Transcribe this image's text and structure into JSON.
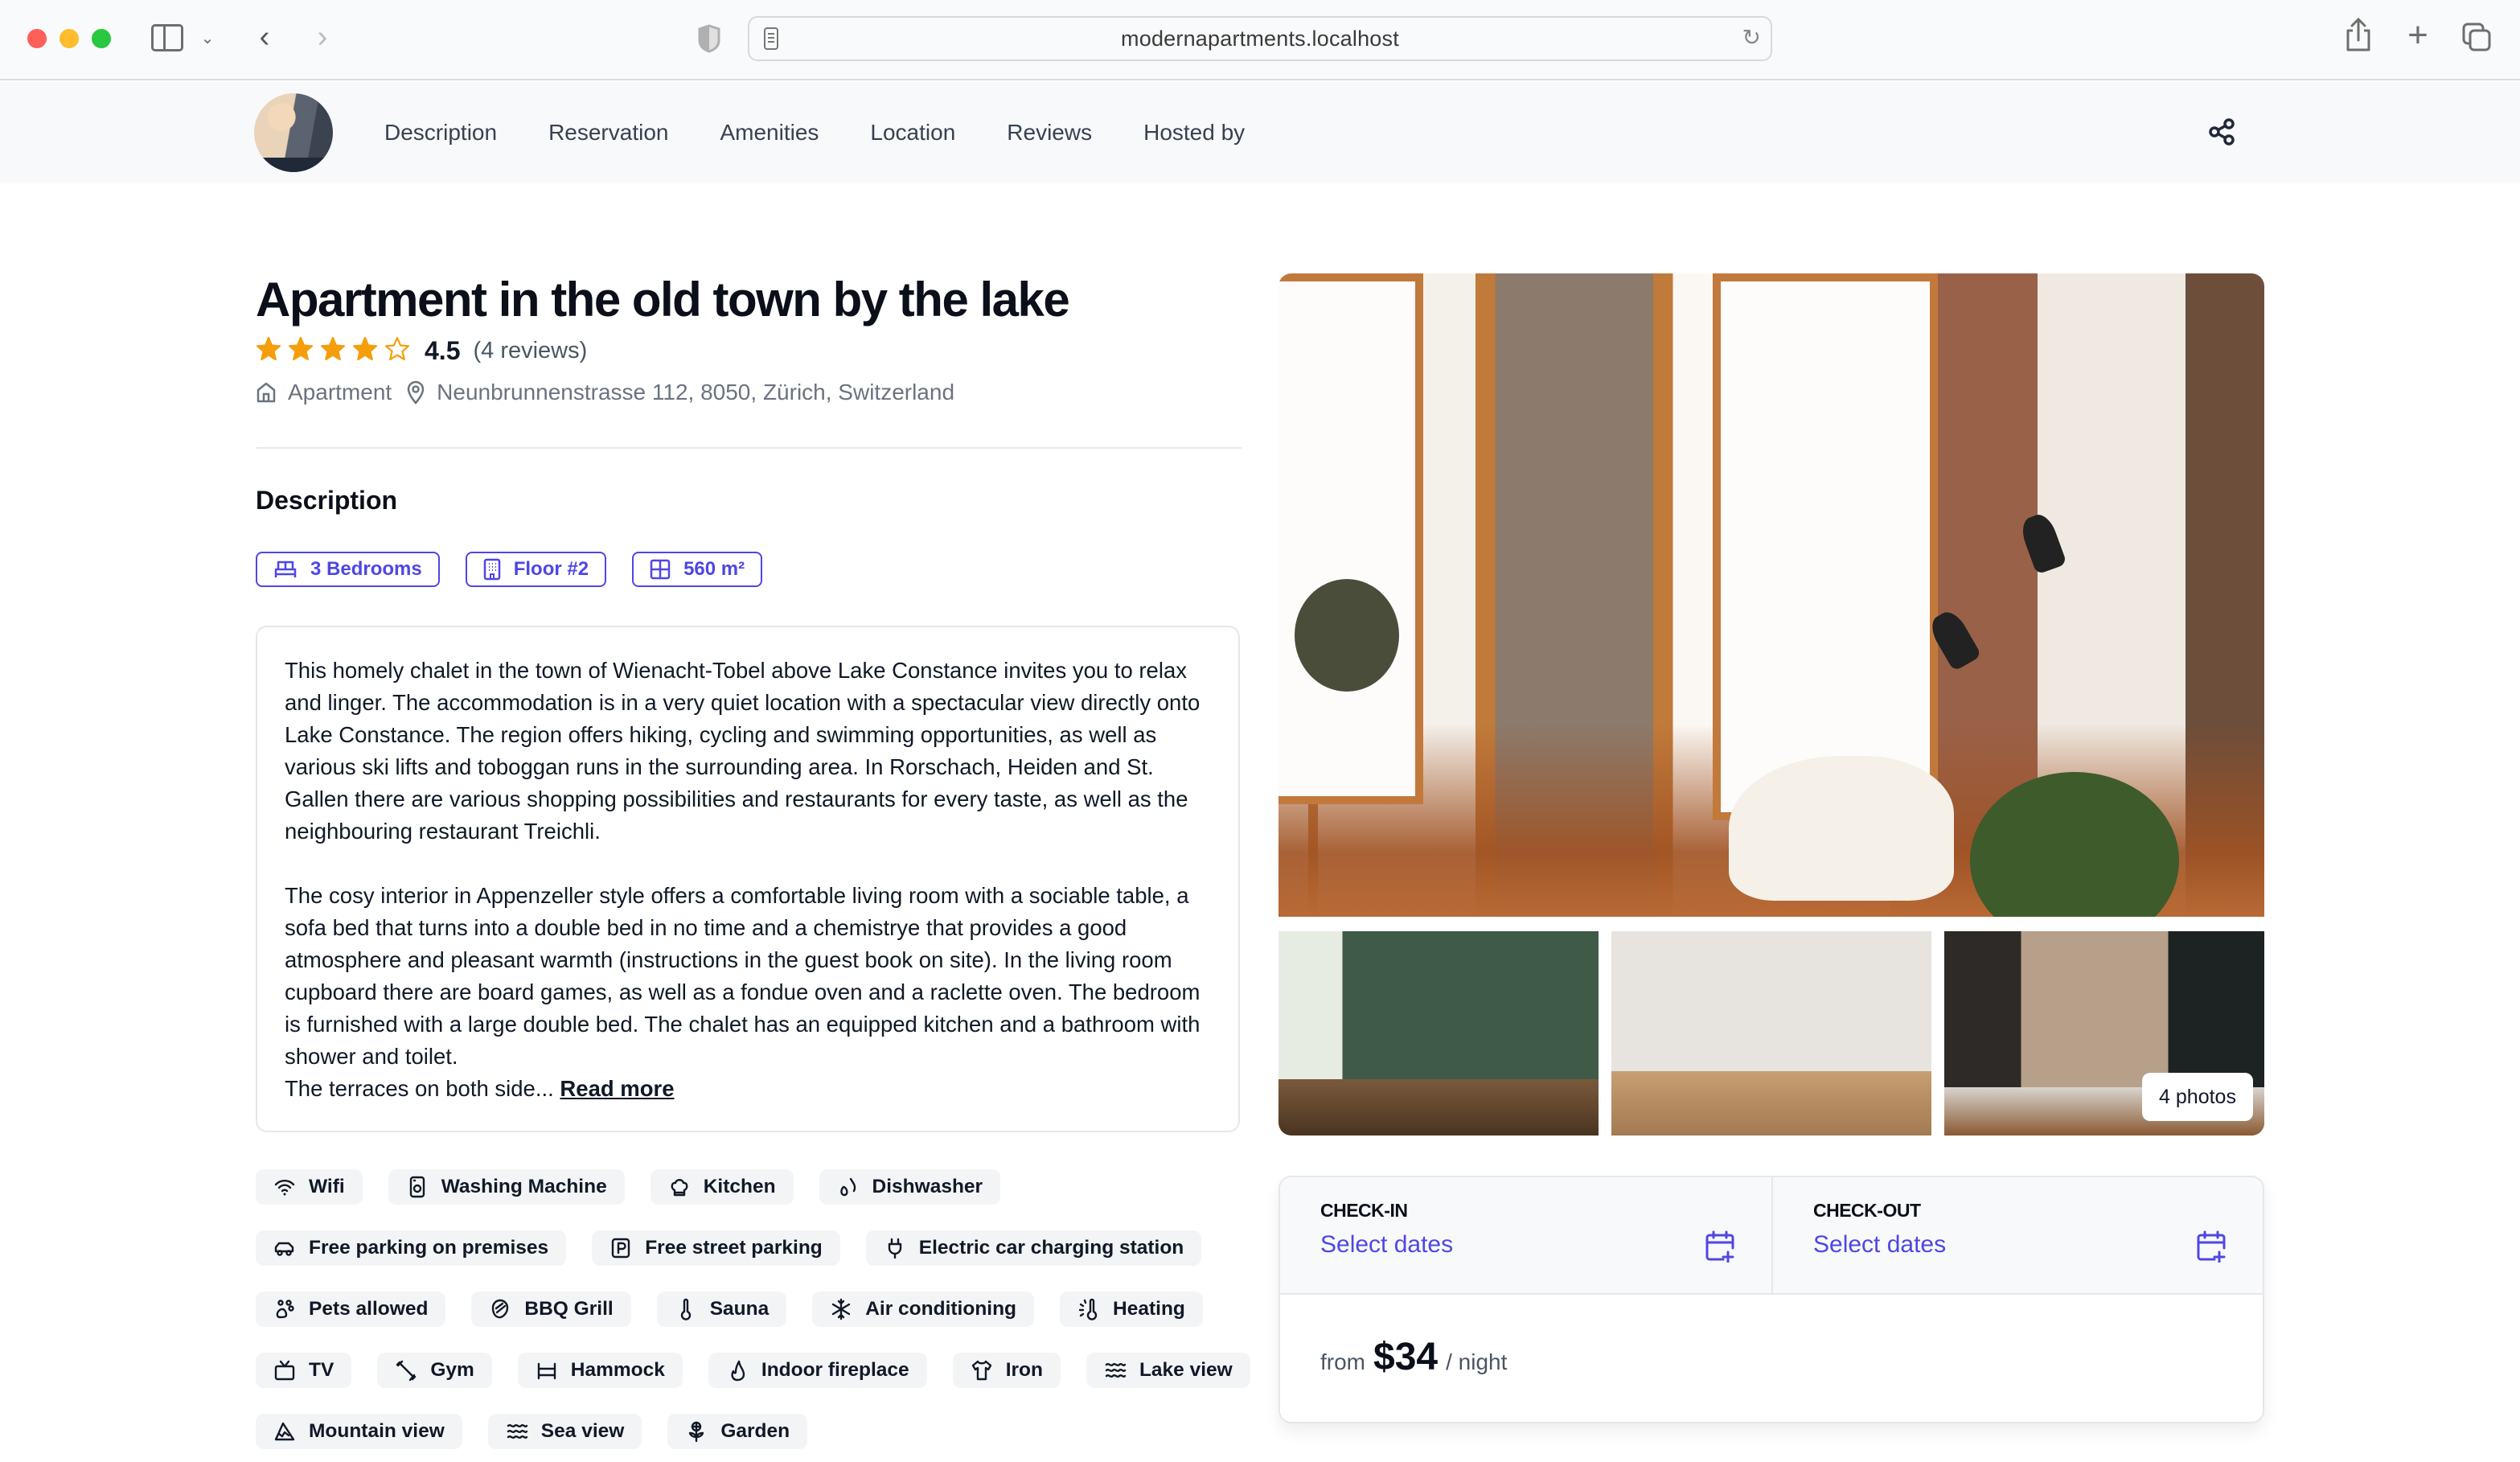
{
  "browser": {
    "url": "modernapartments.localhost"
  },
  "nav": {
    "links": [
      "Description",
      "Reservation",
      "Amenities",
      "Location",
      "Reviews",
      "Hosted by"
    ]
  },
  "listing": {
    "title": "Apartment in the old town by the lake",
    "rating": {
      "value": "4.5",
      "stars": 4.5,
      "max_stars": 5,
      "count_label": "(4 reviews)"
    },
    "type": "Apartment",
    "address": "Neunbrunnenstrasse 112, 8050, Zürich, Switzerland"
  },
  "description": {
    "title": "Description",
    "features": [
      {
        "icon": "bed-icon",
        "label": "3 Bedrooms"
      },
      {
        "icon": "building-icon",
        "label": "Floor #2"
      },
      {
        "icon": "area-grid-icon",
        "label": "560 m²"
      }
    ],
    "paragraph_1": "This homely chalet in the town of Wienacht-Tobel above Lake Constance invites you to relax and linger. The accommodation is in a very quiet location with a spectacular view directly onto Lake Constance. The region offers hiking, cycling and swimming opportunities, as well as various ski lifts and toboggan runs in the surrounding area. In Rorschach, Heiden and St. Gallen there are various shopping possibilities and restaurants for every taste, as well as the neighbouring restaurant Treichli.",
    "paragraph_2": "The cosy interior in Appenzeller style offers a comfortable living room with a sociable table, a sofa bed that turns into a double bed in no time and a chemistrye that provides a good atmosphere and pleasant warmth (instructions in the guest book on site). In the living room cupboard there are board games, as well as a fondue oven and a raclette oven. The bedroom is furnished with a large double bed. The chalet has an equipped kitchen and a bathroom with shower and toilet.",
    "truncated": "The terraces on both side...",
    "read_more": "Read more"
  },
  "amenities": [
    {
      "icon": "wifi-icon",
      "label": "Wifi"
    },
    {
      "icon": "washing-machine-icon",
      "label": "Washing Machine"
    },
    {
      "icon": "chef-hat-icon",
      "label": "Kitchen"
    },
    {
      "icon": "droplets-icon",
      "label": "Dishwasher"
    },
    {
      "icon": "car-icon",
      "label": "Free parking on premises"
    },
    {
      "icon": "parking-sign-icon",
      "label": "Free street parking"
    },
    {
      "icon": "plug-icon",
      "label": "Electric car charging station"
    },
    {
      "icon": "paw-icon",
      "label": "Pets allowed"
    },
    {
      "icon": "grill-icon",
      "label": "BBQ Grill"
    },
    {
      "icon": "thermometer-icon",
      "label": "Sauna"
    },
    {
      "icon": "snowflake-icon",
      "label": "Air conditioning"
    },
    {
      "icon": "thermometer-sun-icon",
      "label": "Heating"
    },
    {
      "icon": "tv-icon",
      "label": "TV"
    },
    {
      "icon": "dumbbell-icon",
      "label": "Gym"
    },
    {
      "icon": "hammock-icon",
      "label": "Hammock"
    },
    {
      "icon": "flame-icon",
      "label": "Indoor fireplace"
    },
    {
      "icon": "shirt-icon",
      "label": "Iron"
    },
    {
      "icon": "waves-icon",
      "label": "Lake view"
    },
    {
      "icon": "mountain-icon",
      "label": "Mountain view"
    },
    {
      "icon": "waves-icon",
      "label": "Sea view"
    },
    {
      "icon": "flower-icon",
      "label": "Garden"
    }
  ],
  "gallery": {
    "photos_label": "4 photos"
  },
  "booking": {
    "checkin_label": "CHECK-IN",
    "checkin_value": "Select dates",
    "checkout_label": "CHECK-OUT",
    "checkout_value": "Select dates",
    "price_prefix": "from",
    "price": "$34",
    "price_suffix": "/ night"
  },
  "colors": {
    "accent": "#4f46e5",
    "star": "#f59e0b",
    "chip_bg": "#f3f4f6"
  }
}
